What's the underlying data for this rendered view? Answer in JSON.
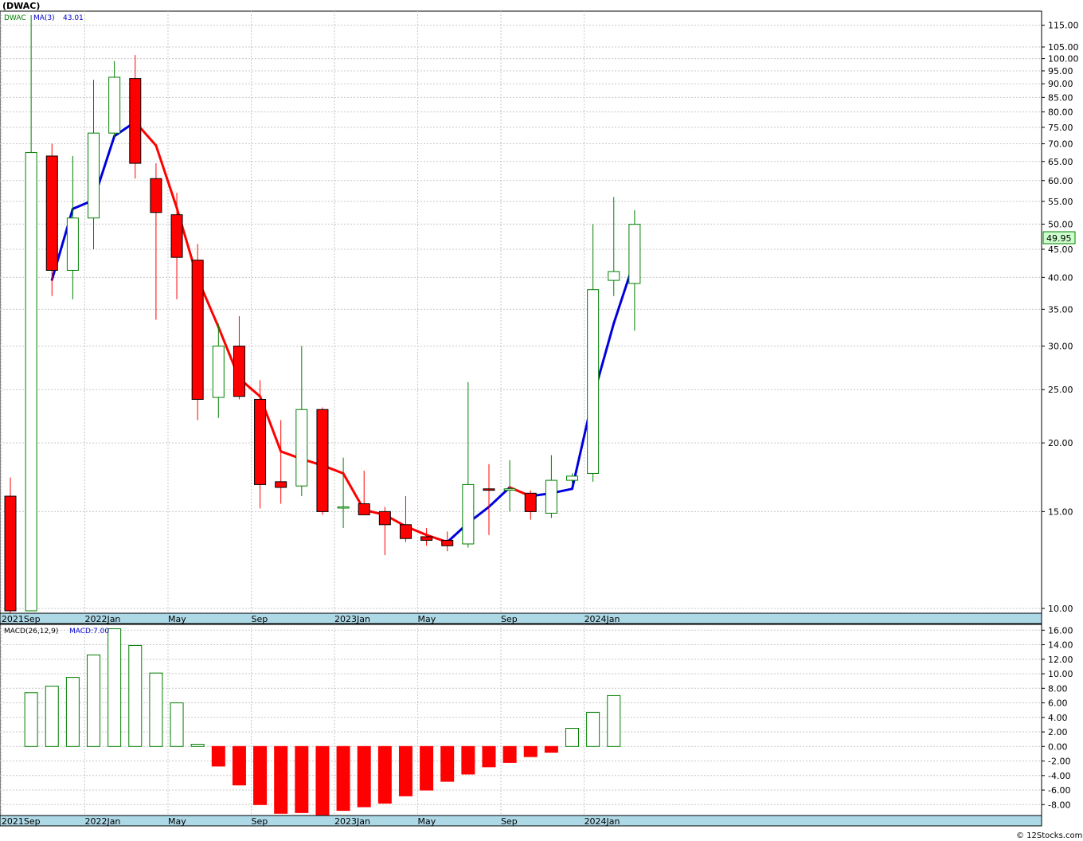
{
  "title": "(DWAC)",
  "footer": "© 12Stocks.com",
  "legend": {
    "ticker": "DWAC",
    "ma_label": "MA(3)",
    "ma_value": "43.01",
    "macd_label": "MACD(26,12,9)",
    "macd_value_label": "MACD:7.00"
  },
  "colors": {
    "up": "#008000",
    "down": "#ff0000",
    "ma_up": "#0000dd",
    "ma_down": "#ff0000",
    "axis_strip": "#add8e6",
    "last_price_bg": "#ccffcc"
  },
  "chart_data": [
    {
      "type": "candlestick",
      "scale": "log",
      "ylim": [
        9.8,
        122
      ],
      "y_ticks": [
        "115.00",
        "105.00",
        "100.00",
        "95.00",
        "90.00",
        "85.00",
        "80.00",
        "75.00",
        "70.00",
        "65.00",
        "60.00",
        "55.00",
        "50.00",
        "45.00",
        "40.00",
        "35.00",
        "30.00",
        "25.00",
        "20.00",
        "15.00",
        "10.00"
      ],
      "x_labels": [
        "2021Sep",
        "2022Jan",
        "May",
        "Sep",
        "2023Jan",
        "May",
        "Sep",
        "2024Jan"
      ],
      "last_price": "49.95",
      "grid": true,
      "candles": [
        {
          "o": 16.0,
          "h": 17.3,
          "l": 9.8,
          "c": 9.9
        },
        {
          "o": 9.9,
          "h": 120,
          "l": 9.9,
          "c": 67.5
        },
        {
          "o": 66.5,
          "h": 70,
          "l": 37,
          "c": 41.2
        },
        {
          "o": 41.2,
          "h": 66.5,
          "l": 36.5,
          "c": 51.3
        },
        {
          "o": 51.3,
          "h": 91.5,
          "l": 45,
          "c": 73.2
        },
        {
          "o": 73.2,
          "h": 99,
          "l": 72,
          "c": 92.5
        },
        {
          "o": 92,
          "h": 101.5,
          "l": 60.5,
          "c": 64.5
        },
        {
          "o": 60.5,
          "h": 64.5,
          "l": 33.5,
          "c": 52.5
        },
        {
          "o": 52,
          "h": 57,
          "l": 36.5,
          "c": 43.5
        },
        {
          "o": 43,
          "h": 46,
          "l": 22,
          "c": 24
        },
        {
          "o": 24.2,
          "h": 33,
          "l": 22.2,
          "c": 30
        },
        {
          "o": 30,
          "h": 34,
          "l": 24,
          "c": 24.3
        },
        {
          "o": 24,
          "h": 26,
          "l": 15.2,
          "c": 16.8
        },
        {
          "o": 17,
          "h": 22,
          "l": 15.5,
          "c": 16.6
        },
        {
          "o": 16.7,
          "h": 30,
          "l": 16,
          "c": 23
        },
        {
          "o": 23,
          "h": 23.2,
          "l": 14.8,
          "c": 15
        },
        {
          "o": 15.3,
          "h": 18.8,
          "l": 14,
          "c": 15.3
        },
        {
          "o": 15.5,
          "h": 17.8,
          "l": 14.8,
          "c": 14.8
        },
        {
          "o": 15,
          "h": 15.3,
          "l": 12.5,
          "c": 14.2
        },
        {
          "o": 14.2,
          "h": 16,
          "l": 13.2,
          "c": 13.4
        },
        {
          "o": 13.5,
          "h": 14,
          "l": 13,
          "c": 13.3
        },
        {
          "o": 13.3,
          "h": 13.8,
          "l": 12.7,
          "c": 13
        },
        {
          "o": 13.1,
          "h": 25.8,
          "l": 12.9,
          "c": 16.8
        },
        {
          "o": 16.5,
          "h": 18.3,
          "l": 13.6,
          "c": 16.4
        },
        {
          "o": 16.4,
          "h": 18.6,
          "l": 15,
          "c": 16.5
        },
        {
          "o": 16.2,
          "h": 16.4,
          "l": 14.5,
          "c": 15
        },
        {
          "o": 14.9,
          "h": 19,
          "l": 14.6,
          "c": 17.1
        },
        {
          "o": 17.1,
          "h": 17.6,
          "l": 16.9,
          "c": 17.4
        },
        {
          "o": 17.6,
          "h": 50,
          "l": 17,
          "c": 38
        },
        {
          "o": 39.5,
          "h": 56,
          "l": 37,
          "c": 41
        },
        {
          "o": 39,
          "h": 53,
          "l": 32,
          "c": 49.95
        }
      ],
      "ma3": [
        null,
        null,
        39.6,
        53.3,
        55.3,
        72.3,
        76.7,
        69.5,
        53.5,
        39.8,
        32.5,
        26.2,
        24.3,
        19.3,
        18.7,
        18.2,
        17.6,
        15.1,
        14.8,
        14.1,
        13.6,
        13.2,
        14.3,
        15.3,
        16.6,
        16,
        16.2,
        16.5,
        24.2,
        33,
        43.01
      ],
      "ma3_color": [
        "",
        "",
        "up",
        "up",
        "up",
        "up",
        "up",
        "down",
        "down",
        "down",
        "down",
        "down",
        "down",
        "down",
        "down",
        "down",
        "down",
        "down",
        "down",
        "down",
        "down",
        "down",
        "up",
        "up",
        "up",
        "down",
        "up",
        "up",
        "up",
        "up",
        "up"
      ]
    },
    {
      "type": "bar",
      "name": "MACD(26,12,9)",
      "ylim": [
        -9.5,
        16.8
      ],
      "y_ticks": [
        "16.00",
        "14.00",
        "12.00",
        "10.00",
        "8.00",
        "6.00",
        "4.00",
        "2.00",
        "0.00",
        "-2.00",
        "-4.00",
        "-6.00",
        "-8.00"
      ],
      "x_labels": [
        "2021Sep",
        "2022Jan",
        "May",
        "Sep",
        "2023Jan",
        "May",
        "Sep",
        "2024Jan"
      ],
      "values": [
        null,
        7.4,
        8.3,
        9.5,
        12.6,
        16.2,
        13.9,
        10.1,
        6.0,
        0.3,
        -2.7,
        -5.3,
        -8.0,
        -9.2,
        -9.1,
        -9.4,
        -8.8,
        -8.3,
        -7.8,
        -6.8,
        -6.0,
        -4.8,
        -3.8,
        -2.8,
        -2.2,
        -1.4,
        -0.8,
        2.5,
        4.7,
        7.0
      ]
    }
  ]
}
